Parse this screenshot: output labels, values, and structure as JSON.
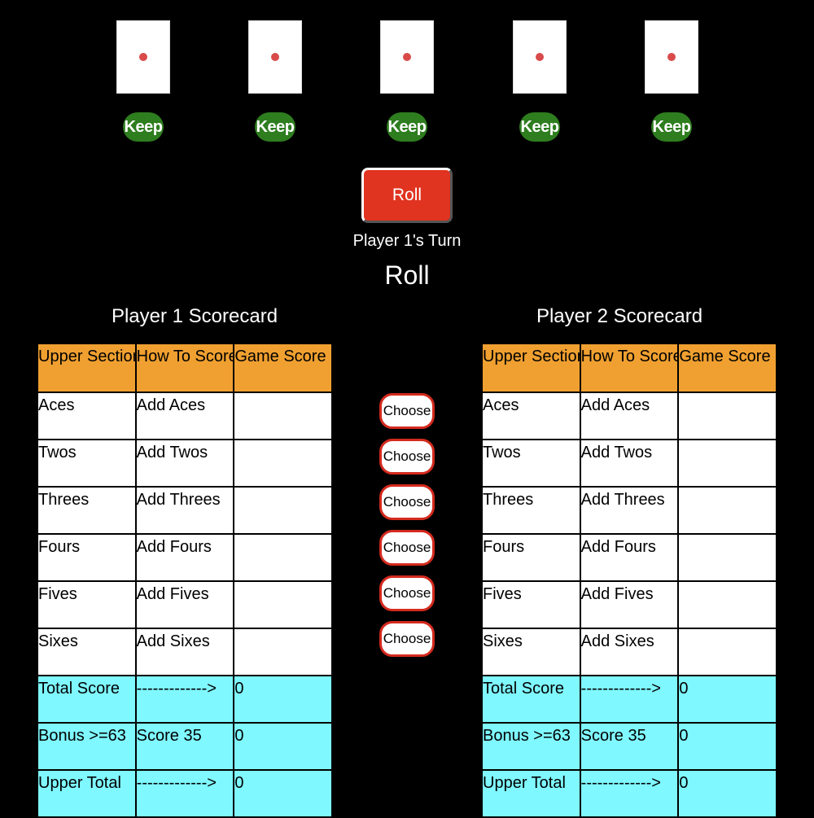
{
  "dice": [
    {
      "value": 1,
      "keep_label": "Keep"
    },
    {
      "value": 1,
      "keep_label": "Keep"
    },
    {
      "value": 1,
      "keep_label": "Keep"
    },
    {
      "value": 1,
      "keep_label": "Keep"
    },
    {
      "value": 1,
      "keep_label": "Keep"
    }
  ],
  "roll_button": "Roll",
  "turn_text": "Player 1's Turn",
  "phase_text": "Roll",
  "players": [
    {
      "title": "Player 1 Scorecard",
      "headers": [
        "Upper Section",
        "How To Score",
        "Game Score"
      ],
      "rows": [
        [
          "Aces",
          "Add Aces",
          ""
        ],
        [
          "Twos",
          "Add Twos",
          ""
        ],
        [
          "Threes",
          "Add Threes",
          ""
        ],
        [
          "Fours",
          "Add Fours",
          ""
        ],
        [
          "Fives",
          "Add Fives",
          ""
        ],
        [
          "Sixes",
          "Add Sixes",
          ""
        ]
      ],
      "totals": [
        [
          "Total Score",
          "------------->",
          "0"
        ],
        [
          "Bonus >=63",
          "Score 35",
          "0"
        ],
        [
          "Upper Total",
          "------------->",
          "0"
        ]
      ]
    },
    {
      "title": "Player 2 Scorecard",
      "headers": [
        "Upper Section",
        "How To Score",
        "Game Score"
      ],
      "rows": [
        [
          "Aces",
          "Add Aces",
          ""
        ],
        [
          "Twos",
          "Add Twos",
          ""
        ],
        [
          "Threes",
          "Add Threes",
          ""
        ],
        [
          "Fours",
          "Add Fours",
          ""
        ],
        [
          "Fives",
          "Add Fives",
          ""
        ],
        [
          "Sixes",
          "Add Sixes",
          ""
        ]
      ],
      "totals": [
        [
          "Total Score",
          "------------->",
          "0"
        ],
        [
          "Bonus >=63",
          "Score 35",
          "0"
        ],
        [
          "Upper Total",
          "------------->",
          "0"
        ]
      ]
    }
  ],
  "choose_buttons": [
    "Choose",
    "Choose",
    "Choose",
    "Choose",
    "Choose",
    "Choose"
  ],
  "colors": {
    "keep_button": "#2e7d1f",
    "roll_button": "#e03320",
    "header_row": "#f0a030",
    "total_rows": "#7ff8ff",
    "pip": "#d94a4a"
  }
}
